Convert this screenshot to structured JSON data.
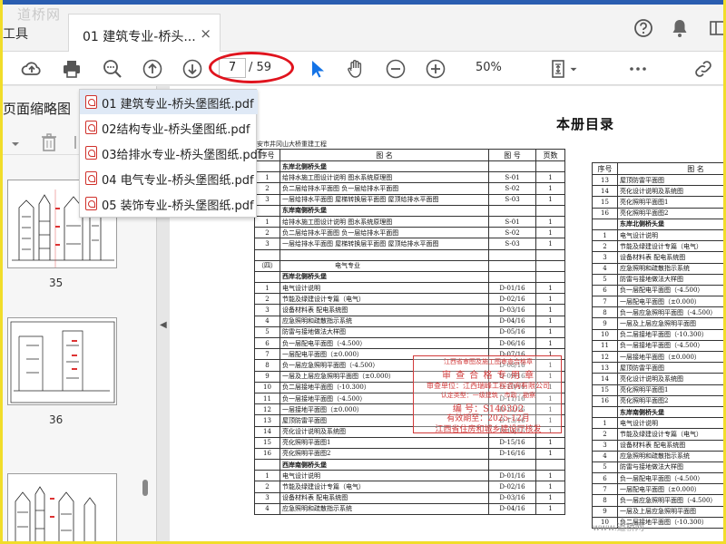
{
  "watermark_top": "道桥网",
  "watermark_bottom": "www.道桥网",
  "tabs": {
    "tools_label": "工具",
    "active_label": "01 建筑专业-桥头...",
    "close_label": "×"
  },
  "header_icons": [
    "help-icon",
    "bell-icon",
    "menu-icon"
  ],
  "toolbar": {
    "page_current": "7",
    "page_total": "/ 59",
    "zoom": "50%",
    "icons": [
      "cloud-upload-icon",
      "print-icon",
      "zoom-search-icon",
      "page-up-icon",
      "page-down-icon",
      "select-arrow-icon",
      "hand-icon",
      "zoom-out-icon",
      "zoom-in-icon",
      "fit-page-icon",
      "more-icon",
      "link-icon"
    ]
  },
  "left_panel": {
    "title": "页面缩略图",
    "thumbnail_numbers": [
      "35",
      "36"
    ]
  },
  "file_dropdown": [
    {
      "label": "01 建筑专业-桥头堡图纸.pdf",
      "selected": true
    },
    {
      "label": "02结构专业-桥头堡图纸.pdf",
      "selected": false
    },
    {
      "label": "03给排水专业-桥头堡图纸.pdf",
      "selected": false
    },
    {
      "label": "04 电气专业-桥头堡图纸.pdf",
      "selected": false
    },
    {
      "label": "05 装饰专业-桥头堡图纸.pdf",
      "selected": false
    }
  ],
  "document": {
    "title": "本册目录",
    "subtitle": "安市井冈山大桥重建工程",
    "headers": [
      "序号",
      "图 名",
      "图 号",
      "页数"
    ],
    "left_rows": [
      [
        "",
        "东岸北侧桥头堡",
        "",
        "",
        "sec"
      ],
      [
        "1",
        "给排水施工图设计说明 图水系统原理图",
        "S-01",
        "1",
        ""
      ],
      [
        "2",
        "负二层给排水平面图 负一层给排水平面图",
        "S-02",
        "1",
        ""
      ],
      [
        "3",
        "一层给排水平面图 屋梯转换层平面图 屋顶给排水平面图",
        "S-03",
        "1",
        ""
      ],
      [
        "",
        "东岸南侧桥头堡",
        "",
        "",
        "sec"
      ],
      [
        "1",
        "给排水施工图设计说明 图水系统原理图",
        "S-01",
        "1",
        ""
      ],
      [
        "2",
        "负二层给排水平面图 负一层给排水平面图",
        "S-02",
        "1",
        ""
      ],
      [
        "3",
        "一层给排水平面图 屋梯转换层平面图 屋顶给排水平面图",
        "S-03",
        "1",
        ""
      ],
      [
        "",
        "",
        "",
        "",
        ""
      ],
      [
        "（四）",
        "电气专业",
        "",
        "",
        "cat"
      ],
      [
        "",
        "西岸北侧桥头堡",
        "",
        "",
        "sec"
      ],
      [
        "1",
        "电气设计说明",
        "D-01/16",
        "1",
        ""
      ],
      [
        "2",
        "节能及绿建设计专篇（电气）",
        "D-02/16",
        "1",
        ""
      ],
      [
        "3",
        "设备材料表 配电系统图",
        "D-03/16",
        "1",
        ""
      ],
      [
        "4",
        "应急照明和疏散指示系统",
        "D-04/16",
        "1",
        ""
      ],
      [
        "5",
        "防雷与接地做法大样图",
        "D-05/16",
        "1",
        ""
      ],
      [
        "6",
        "负一层配电平面图（-4.500）",
        "D-06/16",
        "1",
        ""
      ],
      [
        "7",
        "一层配电平面图（±0.000）",
        "D-07/16",
        "1",
        ""
      ],
      [
        "8",
        "负一层应急照明平面图（-4.500）",
        "D-08/16",
        "1",
        ""
      ],
      [
        "9",
        "一层及上层应急照明平面图（±0.000）",
        "D-09/16",
        "1",
        ""
      ],
      [
        "10",
        "负二层接地平面图（-10.300）",
        "D-10/16",
        "1",
        ""
      ],
      [
        "11",
        "负一层接地平面图（-4.500）",
        "D-11/16",
        "1",
        ""
      ],
      [
        "12",
        "一层接地平面图（±0.000）",
        "D-12/16",
        "1",
        ""
      ],
      [
        "13",
        "屋顶防雷平面图",
        "D-13/16",
        "1",
        ""
      ],
      [
        "14",
        "亮化设计说明及系统图",
        "D-14/16",
        "1",
        ""
      ],
      [
        "15",
        "亮化照明平面图1",
        "D-15/16",
        "1",
        ""
      ],
      [
        "16",
        "亮化照明平面图2",
        "D-16/16",
        "1",
        ""
      ],
      [
        "",
        "西岸南侧桥头堡",
        "",
        "",
        "sec"
      ],
      [
        "1",
        "电气设计说明",
        "D-01/16",
        "1",
        ""
      ],
      [
        "2",
        "节能及绿建设计专篇（电气）",
        "D-02/16",
        "1",
        ""
      ],
      [
        "3",
        "设备材料表 配电系统图",
        "D-03/16",
        "1",
        ""
      ],
      [
        "4",
        "应急照明和疏散指示系统",
        "D-04/16",
        "1",
        ""
      ]
    ],
    "right_rows": [
      [
        "13",
        "屋顶防雷平面图",
        ""
      ],
      [
        "14",
        "亮化设计说明及系统图",
        ""
      ],
      [
        "15",
        "亮化照明平面图1",
        ""
      ],
      [
        "16",
        "亮化照明平面图2",
        ""
      ],
      [
        "",
        "东岸北侧桥头堡",
        "sec"
      ],
      [
        "1",
        "电气设计说明",
        ""
      ],
      [
        "2",
        "节能及绿建设计专篇（电气）",
        ""
      ],
      [
        "3",
        "设备材料表 配电系统图",
        ""
      ],
      [
        "4",
        "应急照明和疏散指示系统",
        ""
      ],
      [
        "5",
        "防雷与接地做法大样图",
        ""
      ],
      [
        "6",
        "负一层配电平面图（-4.500）",
        ""
      ],
      [
        "7",
        "一层配电平面图（±0.000）",
        ""
      ],
      [
        "8",
        "负一层应急照明平面图（-4.500）",
        ""
      ],
      [
        "9",
        "一层及上层应急照明平面图",
        ""
      ],
      [
        "10",
        "负二层接地平面图（-10.300）",
        ""
      ],
      [
        "11",
        "负一层接地平面图（-4.500）",
        ""
      ],
      [
        "12",
        "一层接地平面图（±0.000）",
        ""
      ],
      [
        "13",
        "屋顶防雷平面图",
        ""
      ],
      [
        "14",
        "亮化设计说明及系统图",
        ""
      ],
      [
        "15",
        "亮化照明平面图1",
        ""
      ],
      [
        "16",
        "亮化照明平面图2",
        ""
      ],
      [
        "",
        "东岸南侧桥头堡",
        "sec"
      ],
      [
        "1",
        "电气设计说明",
        ""
      ],
      [
        "2",
        "节能及绿建设计专篇（电气）",
        ""
      ],
      [
        "3",
        "设备材料表 配电系统图",
        ""
      ],
      [
        "4",
        "应急照明和疏散指示系统",
        ""
      ],
      [
        "5",
        "防雷与接地做法大样图",
        ""
      ],
      [
        "6",
        "负一层配电平面图（-4.500）",
        ""
      ],
      [
        "7",
        "一层配电平面图（±0.000）",
        ""
      ],
      [
        "8",
        "负一层应急照明平面图（-4.500）",
        ""
      ],
      [
        "9",
        "一层及上层应急照明平面图",
        ""
      ],
      [
        "10",
        "负二层接地平面图（-10.300）",
        ""
      ]
    ],
    "stamp_lines": [
      "江西省审图及施工图审查合格章",
      "审 查 合 格 专 用 章",
      "审查单位：江西瑞峰工程咨询有限公司",
      "认定类型：一级建筑 · 市政 · 勘察",
      "编 号：S140302",
      "有效期至：2025-12月",
      "江西省住房和城乡建设厅核发"
    ]
  },
  "colors": {
    "accent": "#1473e6",
    "page_highlight": "#e0141e",
    "stamp": "#d23a3a",
    "frame": "#f1dd2a"
  }
}
